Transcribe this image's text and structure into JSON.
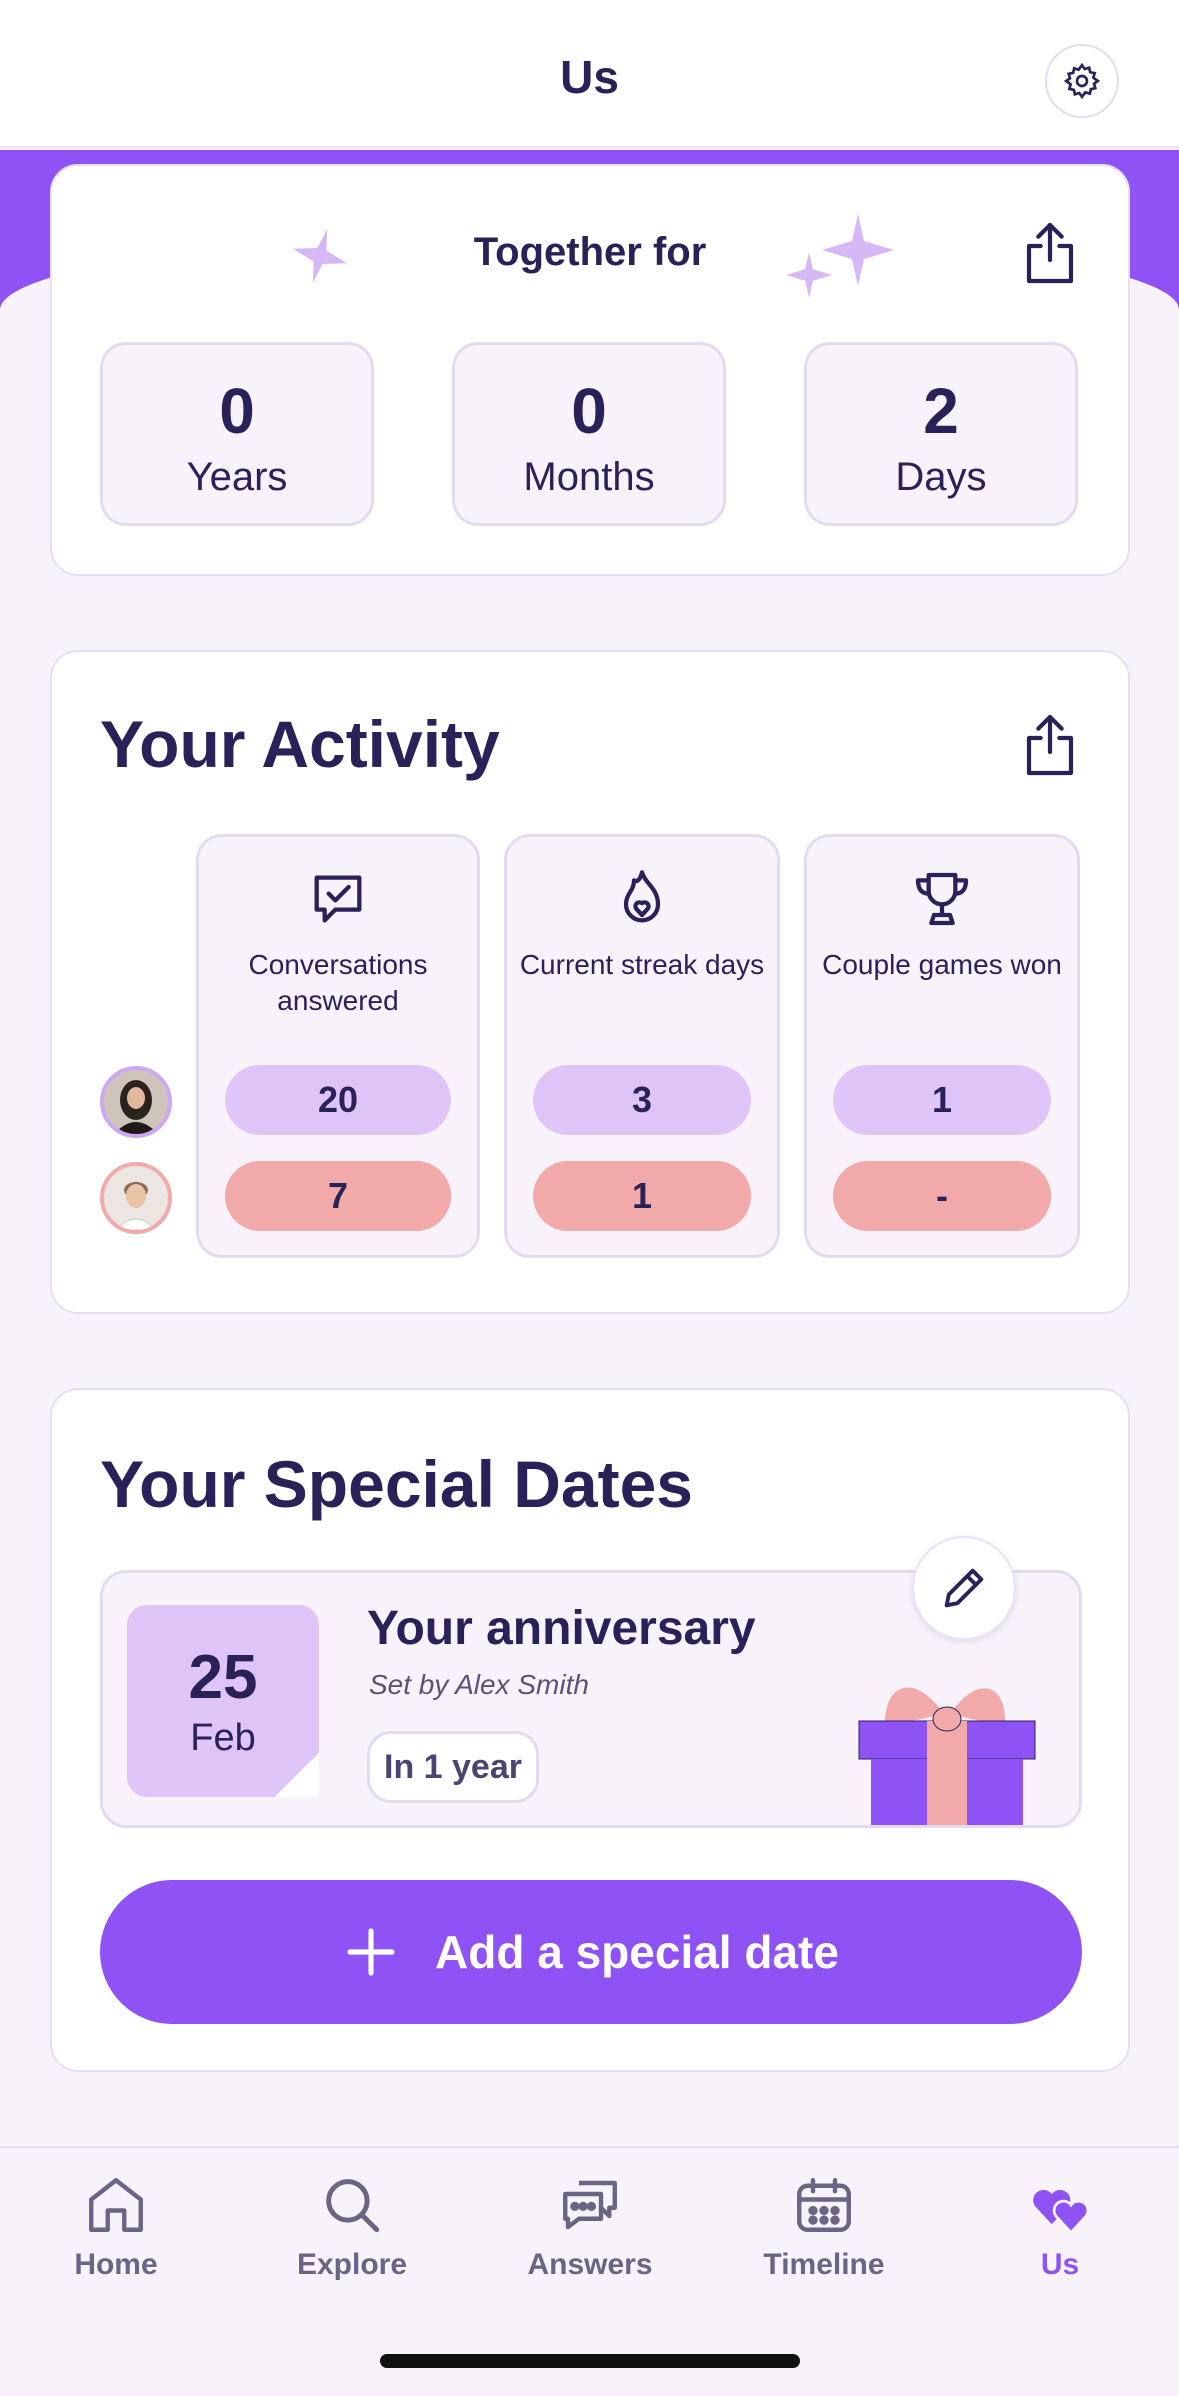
{
  "header": {
    "title": "Us",
    "settings_icon": "gear-icon"
  },
  "together": {
    "title": "Together for",
    "stats": [
      {
        "value": "0",
        "label": "Years"
      },
      {
        "value": "0",
        "label": "Months"
      },
      {
        "value": "2",
        "label": "Days"
      }
    ]
  },
  "activity": {
    "title": "Your Activity",
    "columns": [
      {
        "label": "Conversations answered",
        "icon": "chat-check-icon",
        "user1": "20",
        "user2": "7"
      },
      {
        "label": "Current streak days",
        "icon": "flame-heart-icon",
        "user1": "3",
        "user2": "1"
      },
      {
        "label": "Couple games won",
        "icon": "trophy-icon",
        "user1": "1",
        "user2": "-"
      }
    ]
  },
  "special": {
    "title": "Your Special Dates",
    "item": {
      "day": "25",
      "month": "Feb",
      "title": "Your anniversary",
      "subtitle": "Set by Alex Smith",
      "badge": "In 1 year"
    },
    "add_label": "Add a special date"
  },
  "tabs": [
    {
      "label": "Home",
      "icon": "home-icon"
    },
    {
      "label": "Explore",
      "icon": "search-icon"
    },
    {
      "label": "Answers",
      "icon": "chat-bubbles-icon"
    },
    {
      "label": "Timeline",
      "icon": "calendar-icon"
    },
    {
      "label": "Us",
      "icon": "hearts-icon",
      "active": true
    }
  ],
  "colors": {
    "accent": "#8f52f5",
    "user1_pill": "#dec4f7",
    "user2_pill": "#f2a9a9",
    "text_dark": "#2b2159",
    "background": "#f8f3fb"
  }
}
